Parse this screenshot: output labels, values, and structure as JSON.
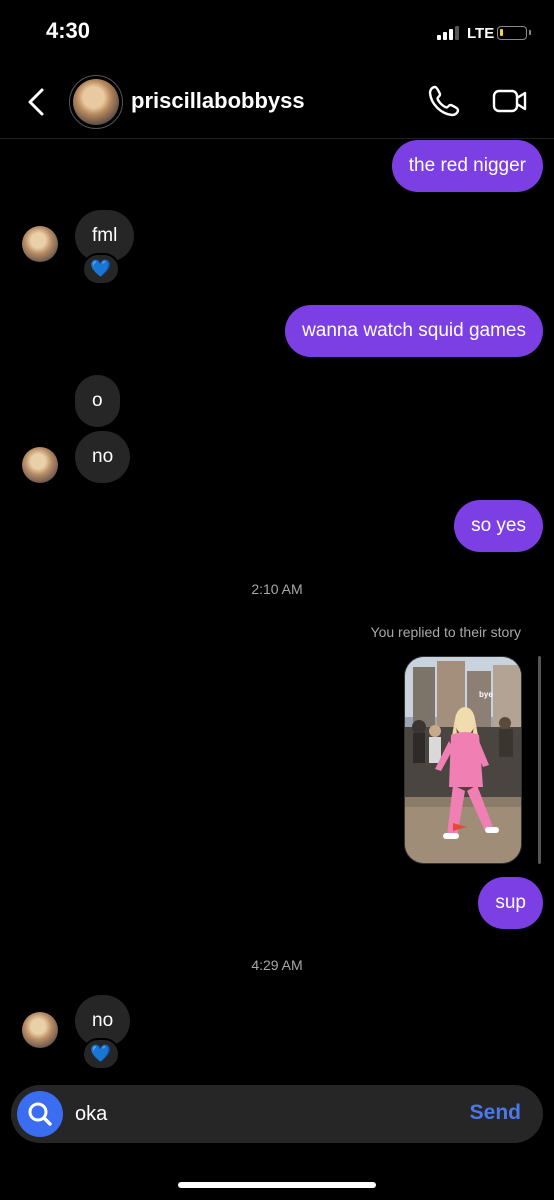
{
  "status_bar": {
    "time": "4:30",
    "network": "LTE"
  },
  "header": {
    "username": "priscillabobbyss"
  },
  "messages": [
    {
      "text": "the red nigger",
      "from": "me"
    },
    {
      "text": "fml",
      "from": "them",
      "reaction": "💙"
    },
    {
      "text": "wanna watch squid games",
      "from": "me"
    },
    {
      "text": "o",
      "from": "them"
    },
    {
      "text": "no",
      "from": "them"
    },
    {
      "text": "so yes",
      "from": "me"
    },
    {
      "text": "sup",
      "from": "me"
    },
    {
      "text": "no",
      "from": "them",
      "reaction": "💙"
    }
  ],
  "timestamps": [
    "2:10 AM",
    "4:29 AM"
  ],
  "story_reply": {
    "note": "You replied to their story",
    "sticker_text": "bye"
  },
  "composer": {
    "value": "oka",
    "send_label": "Send"
  },
  "colors": {
    "sent_bubble": "#7b3fe4",
    "received_bubble": "#262626",
    "accent": "#3b6df0"
  }
}
